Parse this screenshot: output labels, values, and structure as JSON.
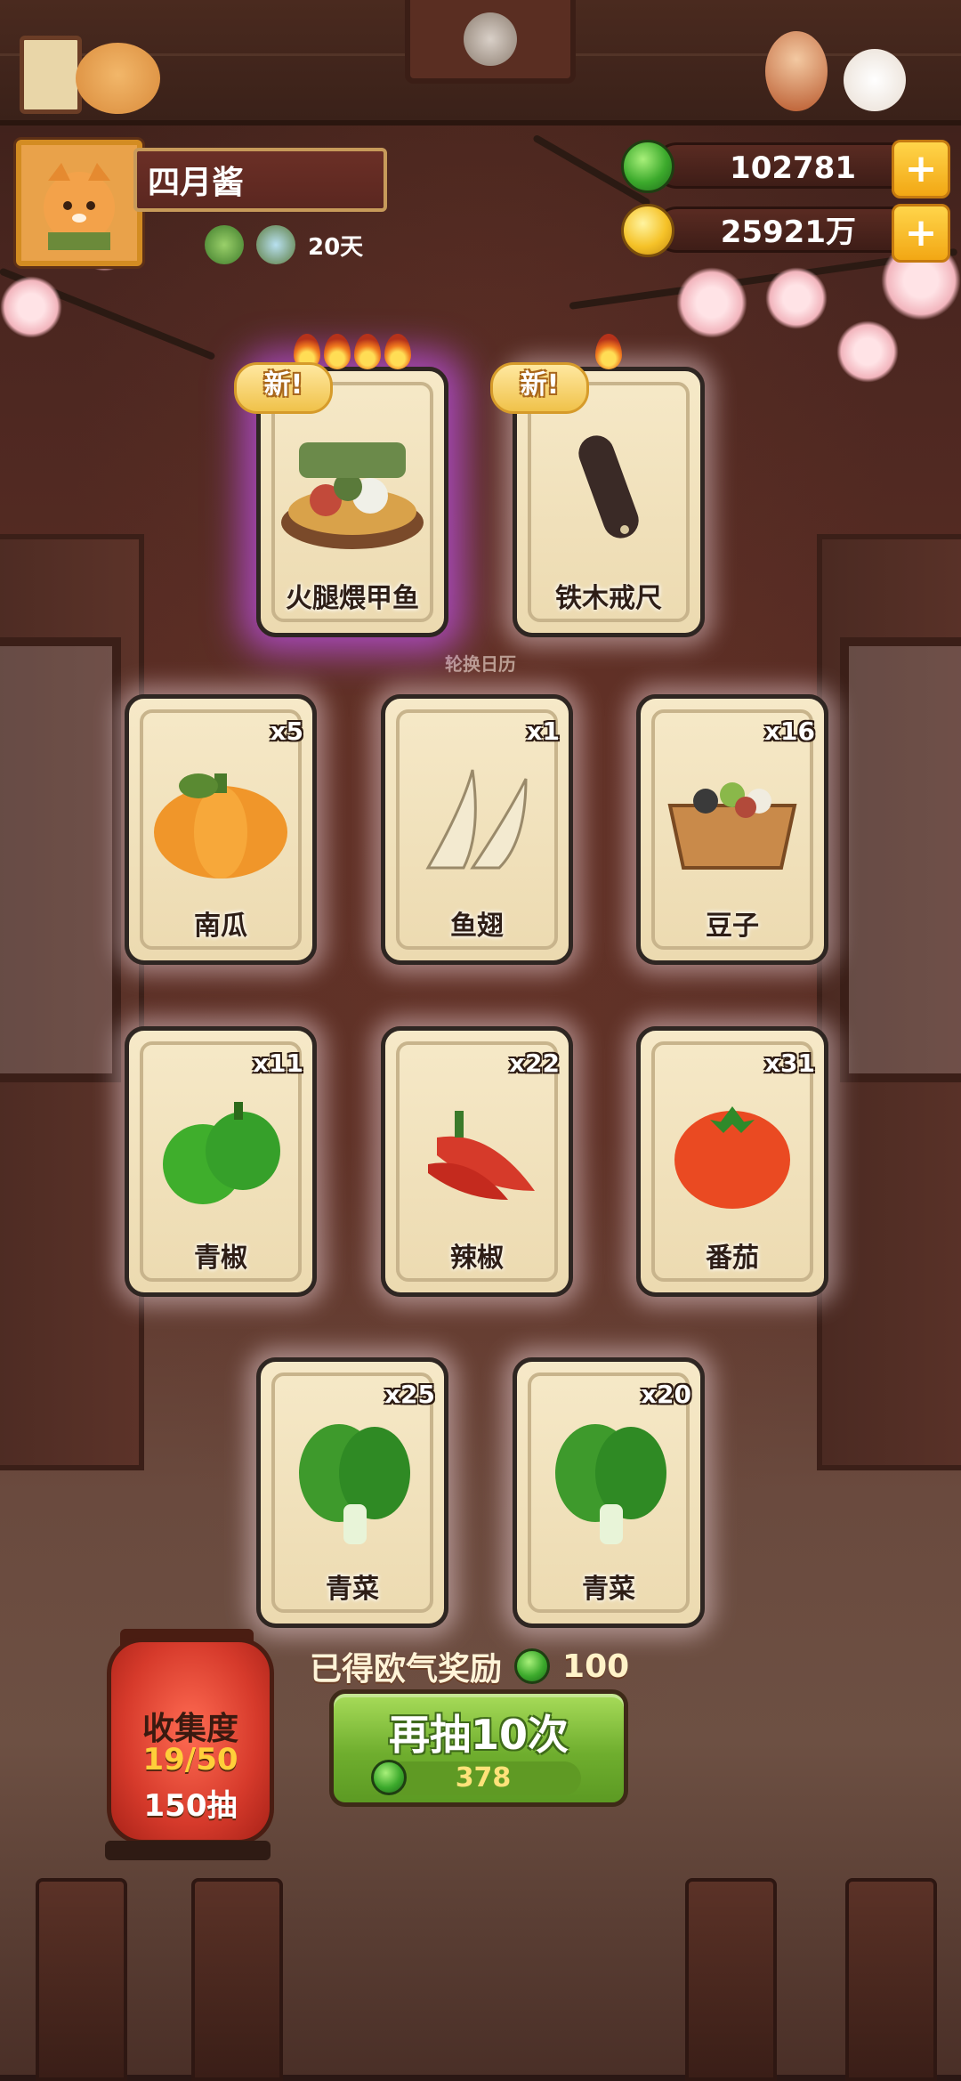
{
  "player": {
    "name": "四月酱",
    "days": "20天"
  },
  "currency": {
    "gems": "102781",
    "coins": "25921万"
  },
  "banner": {
    "calendar_label": "轮换日历"
  },
  "cards": [
    {
      "name": "火腿煨甲鱼",
      "count": "",
      "new_label": "新!",
      "flames": 4,
      "rarity": "purple"
    },
    {
      "name": "铁木戒尺",
      "count": "",
      "new_label": "新!",
      "flames": 1,
      "rarity": "white"
    },
    {
      "name": "南瓜",
      "count": "x5"
    },
    {
      "name": "鱼翅",
      "count": "x1"
    },
    {
      "name": "豆子",
      "count": "x16"
    },
    {
      "name": "青椒",
      "count": "x11"
    },
    {
      "name": "辣椒",
      "count": "x22"
    },
    {
      "name": "番茄",
      "count": "x31"
    },
    {
      "name": "青菜",
      "count": "x25"
    },
    {
      "name": "青菜",
      "count": "x20"
    }
  ],
  "reward": {
    "label": "已得欧气奖励",
    "amount": "100"
  },
  "draw_button": {
    "label": "再抽10次",
    "cost": "378"
  },
  "collection": {
    "title": "收集度",
    "progress": "19/50",
    "pulls": "150抽"
  },
  "colors": {
    "accent_green": "#6fae2e",
    "gold": "#f5c228",
    "rare_glow": "#be50e6"
  }
}
